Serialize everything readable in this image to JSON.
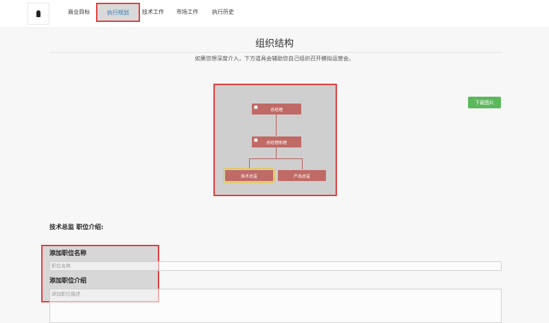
{
  "nav": {
    "items": [
      {
        "label": "商业目标"
      },
      {
        "label": "执行规划"
      },
      {
        "label": "技术工作"
      },
      {
        "label": "市场工作"
      },
      {
        "label": "执行历史"
      }
    ],
    "active_index": 1
  },
  "page": {
    "title": "组织结构",
    "subtitle": "如果您想深度介入，下方道具会辅助您自己组织召开模拟运营会。"
  },
  "org": {
    "nodes": {
      "ceo": "总经理",
      "assistant": "总经理助理",
      "tech": "技术总监",
      "product": "产品总监"
    },
    "selected": "技术总监"
  },
  "download_label": "下载图片",
  "position": {
    "intro_label": "技术总监 职位介绍:",
    "name_label": "添加职位名称",
    "name_placeholder": "职位名称",
    "desc_label": "添加职位介绍",
    "desc_placeholder": "添加职位描述"
  },
  "colors": {
    "node": "#c06a66",
    "accent_red": "#e23b3b",
    "download": "#5cb85c",
    "link_active": "#337ab7"
  }
}
